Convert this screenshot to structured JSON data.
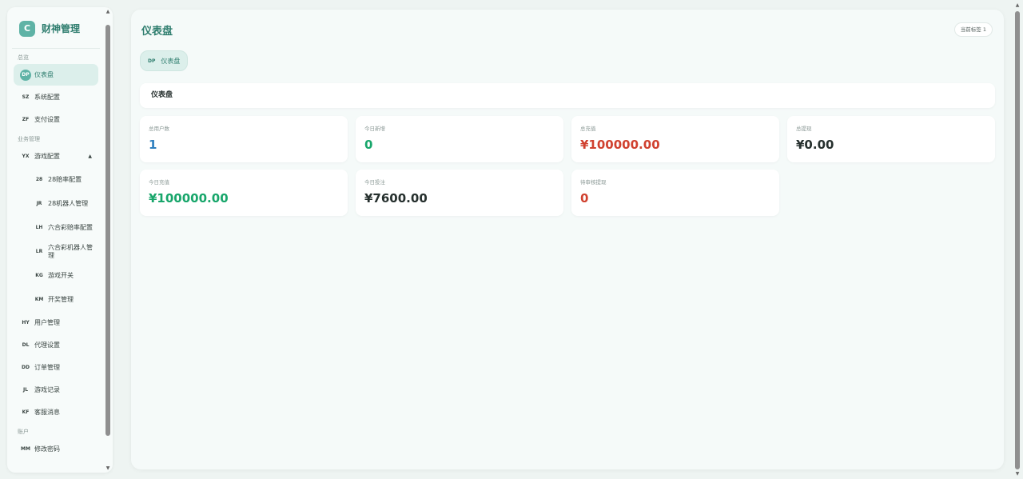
{
  "brand": {
    "logo": "C",
    "name": "财神管理"
  },
  "sidebar": {
    "sections": [
      {
        "label": "总览"
      },
      {
        "label": "业务管理"
      },
      {
        "label": "账户"
      }
    ],
    "items": [
      {
        "badge": "DP",
        "label": "仪表盘"
      },
      {
        "badge": "SZ",
        "label": "系统配置"
      },
      {
        "badge": "ZF",
        "label": "支付设置"
      },
      {
        "badge": "YX",
        "label": "游戏配置",
        "arrow": "▲"
      },
      {
        "badge": "28",
        "label": "28赔率配置"
      },
      {
        "badge": "JR",
        "label": "28机器人管理"
      },
      {
        "badge": "LH",
        "label": "六合彩赔率配置"
      },
      {
        "badge": "LR",
        "label": "六合彩机器人管理"
      },
      {
        "badge": "KG",
        "label": "游戏开关"
      },
      {
        "badge": "KM",
        "label": "开奖管理"
      },
      {
        "badge": "HY",
        "label": "用户管理"
      },
      {
        "badge": "DL",
        "label": "代理设置"
      },
      {
        "badge": "DD",
        "label": "订单管理"
      },
      {
        "badge": "JL",
        "label": "游戏记录"
      },
      {
        "badge": "KF",
        "label": "客服消息"
      },
      {
        "badge": "MM",
        "label": "修改密码"
      }
    ]
  },
  "header": {
    "title": "仪表盘",
    "tag_counter": "当前标签 1"
  },
  "tabs": [
    {
      "badge": "DP",
      "label": "仪表盘"
    }
  ],
  "section": {
    "title": "仪表盘"
  },
  "stats": [
    {
      "label": "总用户数",
      "value": "1",
      "color": "#2f7fbf"
    },
    {
      "label": "今日新增",
      "value": "0",
      "color": "#18a66b"
    },
    {
      "label": "总充值",
      "value": "¥100000.00",
      "color": "#d0412f"
    },
    {
      "label": "总提现",
      "value": "¥0.00",
      "color": "#26302e"
    },
    {
      "label": "今日充值",
      "value": "¥100000.00",
      "color": "#18a66b"
    },
    {
      "label": "今日投注",
      "value": "¥7600.00",
      "color": "#26302e"
    },
    {
      "label": "待审核提现",
      "value": "0",
      "color": "#d0412f"
    }
  ],
  "colors": {
    "accent": "#2e7d6e",
    "accent_soft": "#dcefeb",
    "logo": "#5fb3a6"
  }
}
